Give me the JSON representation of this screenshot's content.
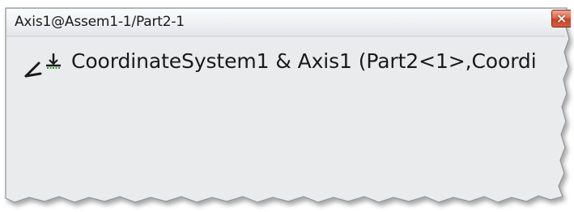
{
  "window": {
    "title": "Axis1@Assem1-1/Part2-1",
    "close_label": "×"
  },
  "mate": {
    "icon": "coincident-mate-icon",
    "text": "CoordinateSystem1 & Axis1 (Part2<1>,Coordi"
  },
  "colors": {
    "panel_bg": "#eaebed",
    "title_gradient_top": "#fafbfc",
    "title_gradient_bottom": "#e4e6ea",
    "close_red": "#d75b3d",
    "border": "#8e9296"
  }
}
